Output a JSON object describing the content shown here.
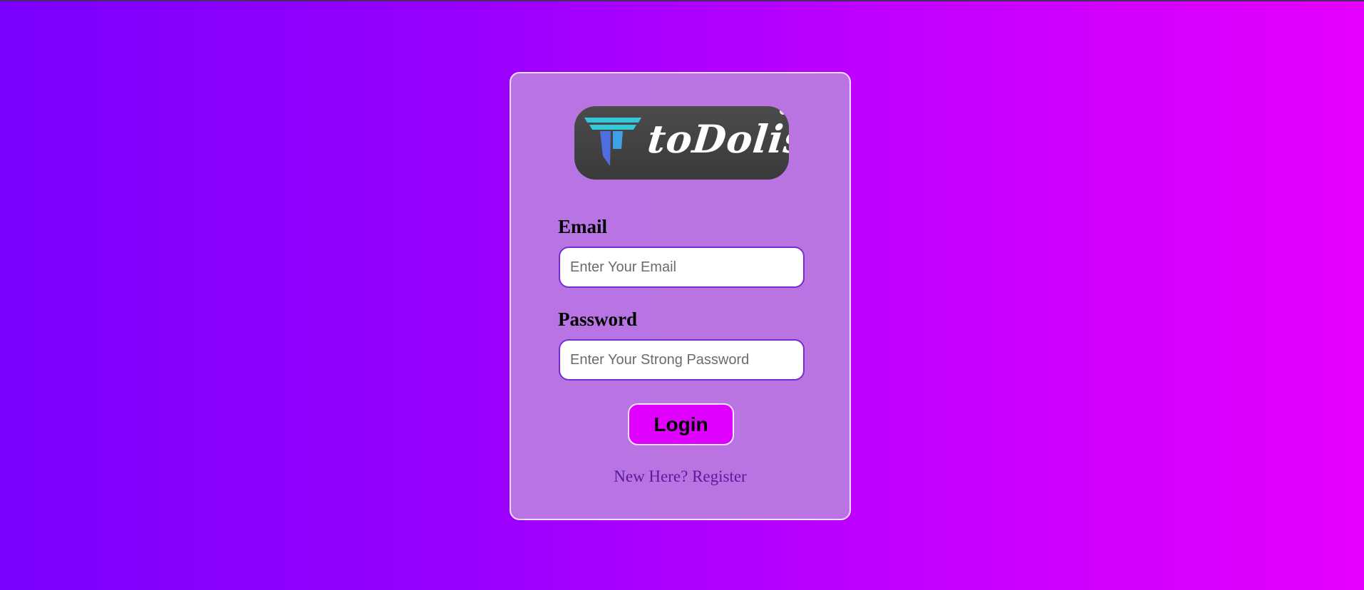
{
  "logo": {
    "text": "toDolist",
    "icon": "todolist-t-logo-icon"
  },
  "form": {
    "email_label": "Email",
    "email_placeholder": "Enter Your Email",
    "email_value": "",
    "password_label": "Password",
    "password_placeholder": "Enter Your Strong Password",
    "password_value": "",
    "login_label": "Login",
    "register_text": "New Here? Register"
  },
  "colors": {
    "gradient_start": "#7a00ff",
    "gradient_end": "#e600ff",
    "card_bg": "#b976e1",
    "button_bg": "#e000ff",
    "input_border": "#7a2bd0",
    "link": "#5a1a9a"
  }
}
